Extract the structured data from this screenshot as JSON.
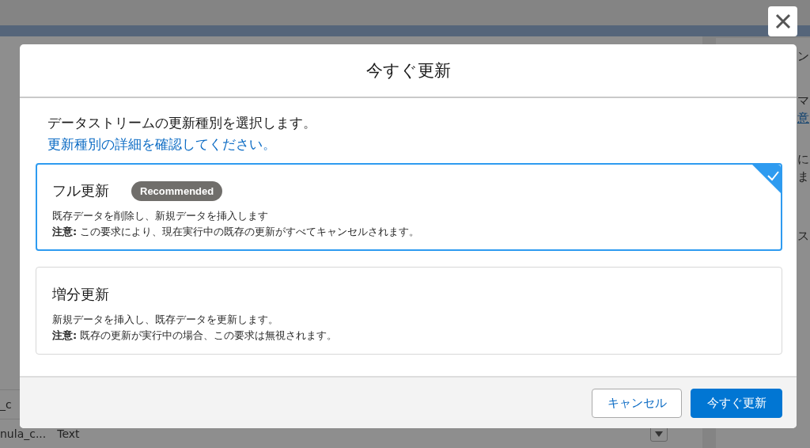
{
  "background": {
    "table_rows": [
      {
        "column_1": "_c"
      },
      {
        "column_1": "nula_c...",
        "column_2": "Text"
      }
    ],
    "side_texts": [
      {
        "text": "ン",
        "kind": "text"
      },
      {
        "text": "マ",
        "kind": "text"
      },
      {
        "text": "意",
        "kind": "link"
      },
      {
        "text": "に",
        "kind": "text"
      },
      {
        "text": "ま",
        "kind": "text"
      },
      {
        "text": "ス",
        "kind": "text"
      }
    ]
  },
  "modal": {
    "title": "今すぐ更新",
    "intro": "データストリームの更新種別を選択します。",
    "help_link": "更新種別の詳細を確認してください。",
    "options": [
      {
        "title": "フル更新",
        "badge": "Recommended",
        "description": "既存データを削除し、新規データを挿入します",
        "note": "**注意:** この要求により、現在実行中の既存の更新がすべてキャンセルされます。",
        "selected": true
      },
      {
        "title": "増分更新",
        "description": "新規データを挿入し、既存データを更新します。",
        "note": "**注意:** 既存の更新が実行中の場合、この要求は無視されます。",
        "selected": false
      }
    ],
    "buttons": [
      {
        "label": "キャンセル",
        "kind": "neutral"
      },
      {
        "label": "今すぐ更新",
        "kind": "brand"
      }
    ]
  }
}
